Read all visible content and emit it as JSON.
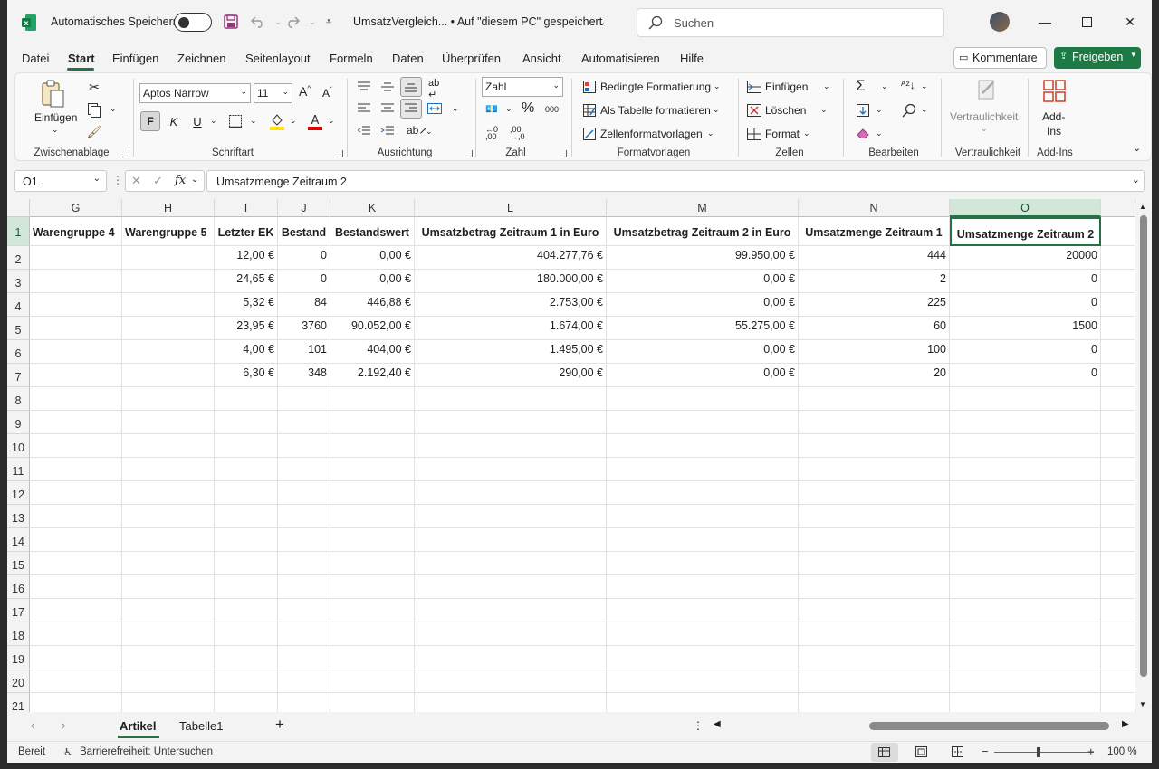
{
  "titlebar": {
    "autosave_label": "Automatisches Speichern",
    "doc_title": "UmsatzVergleich... • Auf \"diesem PC\" gespeichert",
    "search_placeholder": "Suchen"
  },
  "menu": [
    "Datei",
    "Start",
    "Einfügen",
    "Zeichnen",
    "Seitenlayout",
    "Formeln",
    "Daten",
    "Überprüfen",
    "Ansicht",
    "Automatisieren",
    "Hilfe"
  ],
  "menu_buttons": {
    "comments": "Kommentare",
    "share": "Freigeben"
  },
  "ribbon": {
    "clipboard": {
      "paste": "Einfügen",
      "label": "Zwischenablage"
    },
    "font": {
      "name": "Aptos Narrow",
      "size": "11",
      "bold": "F",
      "italic": "K",
      "underline": "U",
      "label": "Schriftart"
    },
    "alignment": {
      "label": "Ausrichtung"
    },
    "number": {
      "format": "Zahl",
      "label": "Zahl"
    },
    "styles": {
      "conditional": "Bedingte Formatierung",
      "as_table": "Als Tabelle formatieren",
      "cell_styles": "Zellenformatvorlagen",
      "label": "Formatvorlagen"
    },
    "cells": {
      "insert": "Einfügen",
      "delete": "Löschen",
      "format": "Format",
      "label": "Zellen"
    },
    "editing": {
      "label": "Bearbeiten"
    },
    "sensitivity": {
      "button": "Vertraulichkeit",
      "label": "Vertraulichkeit"
    },
    "addins": {
      "button_line1": "Add-",
      "button_line2": "Ins",
      "label": "Add-Ins"
    }
  },
  "formula_bar": {
    "name_box": "O1",
    "fx": "fx",
    "content": "Umsatzmenge Zeitraum 2"
  },
  "columns": [
    "G",
    "H",
    "I",
    "J",
    "K",
    "L",
    "M",
    "N",
    "O"
  ],
  "rows": [
    "1",
    "2",
    "3",
    "4",
    "5",
    "6",
    "7",
    "8",
    "9",
    "10",
    "11",
    "12",
    "13",
    "14",
    "15",
    "16",
    "17",
    "18",
    "19",
    "20",
    "21"
  ],
  "header_row": [
    "Warengruppe 4",
    "Warengruppe 5",
    "Letzter EK",
    "Bestand",
    "Bestandswert",
    "Umsatzbetrag Zeitraum 1 in Euro",
    "Umsatzbetrag Zeitraum 2 in Euro",
    "Umsatzmenge Zeitraum 1",
    "Umsatzmenge Zeitraum 2"
  ],
  "data_rows": [
    [
      "",
      "",
      "12,00 €",
      "0",
      "0,00 €",
      "404.277,76 €",
      "99.950,00 €",
      "444",
      "20000"
    ],
    [
      "",
      "",
      "24,65 €",
      "0",
      "0,00 €",
      "180.000,00 €",
      "0,00 €",
      "2",
      "0"
    ],
    [
      "",
      "",
      "5,32 €",
      "84",
      "446,88 €",
      "2.753,00 €",
      "0,00 €",
      "225",
      "0"
    ],
    [
      "",
      "",
      "23,95 €",
      "3760",
      "90.052,00 €",
      "1.674,00 €",
      "55.275,00 €",
      "60",
      "1500"
    ],
    [
      "",
      "",
      "4,00 €",
      "101",
      "404,00 €",
      "1.495,00 €",
      "0,00 €",
      "100",
      "0"
    ],
    [
      "",
      "",
      "6,30 €",
      "348",
      "2.192,40 €",
      "290,00 €",
      "0,00 €",
      "20",
      "0"
    ]
  ],
  "sheets": [
    "Artikel",
    "Tabelle1"
  ],
  "status": {
    "ready": "Bereit",
    "accessibility": "Barrierefreiheit: Untersuchen",
    "zoom": "100 %"
  },
  "colors": {
    "accent": "#217346",
    "share_button": "#1e7a44"
  }
}
